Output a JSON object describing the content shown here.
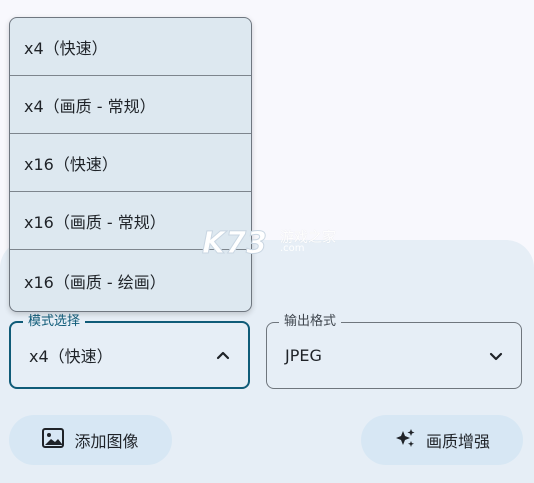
{
  "dropdown": {
    "options": [
      "x4（快速）",
      "x4（画质 - 常规）",
      "x16（快速）",
      "x16（画质 - 常规）",
      "x16（画质 - 绘画）"
    ]
  },
  "mode_field": {
    "label": "模式选择",
    "value": "x4（快速）",
    "icon": "chevron-up-icon"
  },
  "format_field": {
    "label": "输出格式",
    "value": "JPEG",
    "icon": "chevron-down-icon"
  },
  "buttons": {
    "add_image": "添加图像",
    "enhance": "画质增强"
  },
  "watermark": {
    "brand": "K73",
    "site_name": "游戏之家",
    "domain": ".com"
  },
  "colors": {
    "accent": "#0f5b78",
    "panel_background": "#e6eef6",
    "button_background": "#d7e7f4",
    "menu_background": "#dde8f0"
  }
}
